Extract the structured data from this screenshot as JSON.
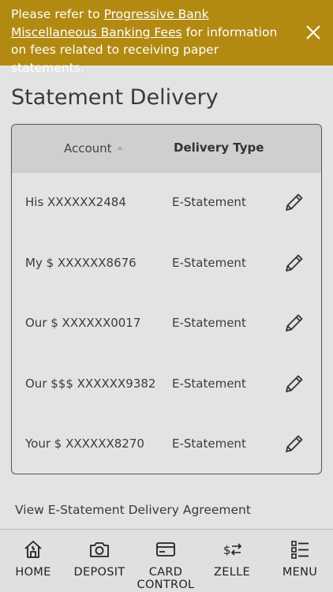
{
  "banner": {
    "text_before": "Please refer to ",
    "link": "Progressive Bank Miscellaneous Banking Fees",
    "text_after": " for information on fees related to receiving paper statements."
  },
  "page_title": "Statement Delivery",
  "table": {
    "headers": {
      "account": "Account",
      "delivery_type": "Delivery Type"
    },
    "rows": [
      {
        "account": "His XXXXXX2484",
        "delivery_type": "E-Statement"
      },
      {
        "account": "My $ XXXXXX8676",
        "delivery_type": "E-Statement"
      },
      {
        "account": "Our $ XXXXXX0017",
        "delivery_type": "E-Statement"
      },
      {
        "account": "Our $$$ XXXXXX9382",
        "delivery_type": "E-Statement"
      },
      {
        "account": "Your $ XXXXXX8270",
        "delivery_type": "E-Statement"
      }
    ]
  },
  "agreement_link": "View E-Statement Delivery Agreement",
  "nav": {
    "items": [
      {
        "label": "HOME",
        "icon": "home-icon"
      },
      {
        "label": "DEPOSIT",
        "icon": "camera-icon"
      },
      {
        "label": "CARD CONTROL",
        "icon": "card-icon"
      },
      {
        "label": "ZELLE",
        "icon": "transfer-icon"
      },
      {
        "label": "MENU",
        "icon": "menu-list-icon"
      }
    ]
  },
  "colors": {
    "banner": "#b28a12",
    "background": "#e3e3e3",
    "header": "#cfcfcf"
  }
}
